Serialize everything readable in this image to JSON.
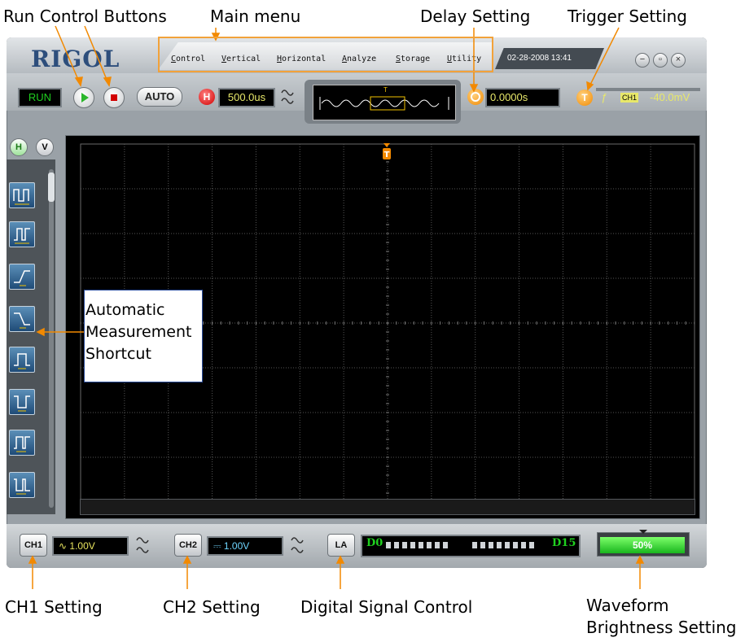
{
  "callouts": {
    "run_control": "Run Control Buttons",
    "main_menu": "Main menu",
    "delay": "Delay Setting",
    "trigger": "Trigger Setting",
    "ch1": "CH1 Setting",
    "ch2": "CH2 Setting",
    "digital": "Digital Signal Control",
    "brightness_line1": "Waveform",
    "brightness_line2": "Brightness Setting",
    "shortcut_line1": "Automatic",
    "shortcut_line2": "Measurement",
    "shortcut_line3": "Shortcut"
  },
  "app": {
    "logo": "RIGOL",
    "date": "02-28-2008 13:41"
  },
  "menu": {
    "items": [
      "Control",
      "Vertical",
      "Horizontal",
      "Analyze",
      "Storage",
      "Utility"
    ]
  },
  "toolbar": {
    "run_status": "RUN",
    "auto_label": "AUTO",
    "h_label": "H",
    "timebase": "500.0us",
    "trigger_marker": "T",
    "delay_value": "0.0000s",
    "trigger_badge": "T",
    "trigger_channel": "CH1",
    "trigger_level": "-40.0mV"
  },
  "left_tabs": {
    "h": "H",
    "v": "V"
  },
  "bottom": {
    "ch1_label": "CH1",
    "ch1_scale": "1.00V",
    "ch2_label": "CH2",
    "ch2_scale": "1.00V",
    "la_label": "LA",
    "d_start": "D0",
    "d_end": "D15",
    "brightness": "50%"
  },
  "colors": {
    "accent_orange": "#f28900",
    "lcd_text": "#e8e86a",
    "brightness_green": "#19b51d",
    "callout_line": "#f28900"
  }
}
